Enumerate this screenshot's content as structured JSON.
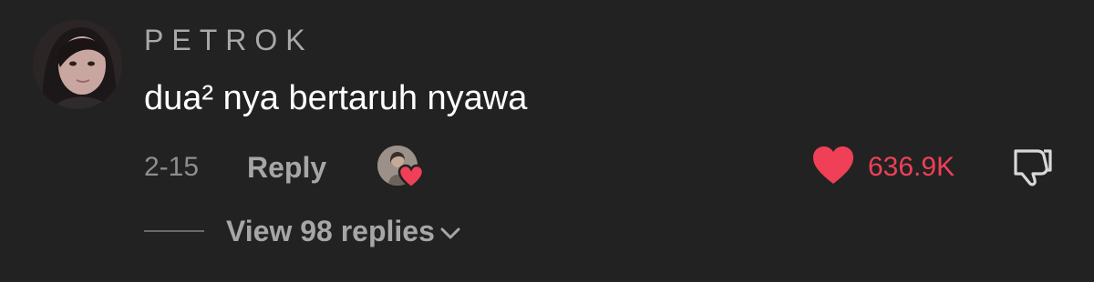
{
  "comment": {
    "username": "PETROK",
    "text": "dua² nya bertaruh nyawa",
    "date": "2-15",
    "reply_label": "Reply",
    "like_count": "636.9K",
    "view_replies_label": "View 98 replies"
  },
  "colors": {
    "background": "#222222",
    "like_red": "#ef4058",
    "muted_text": "#a6a6a6"
  },
  "icons": {
    "avatar": "user-avatar",
    "creator_liked": "creator-liked-heart-icon",
    "like": "heart-icon",
    "dislike": "thumbs-down-icon",
    "expand": "chevron-down-icon"
  }
}
